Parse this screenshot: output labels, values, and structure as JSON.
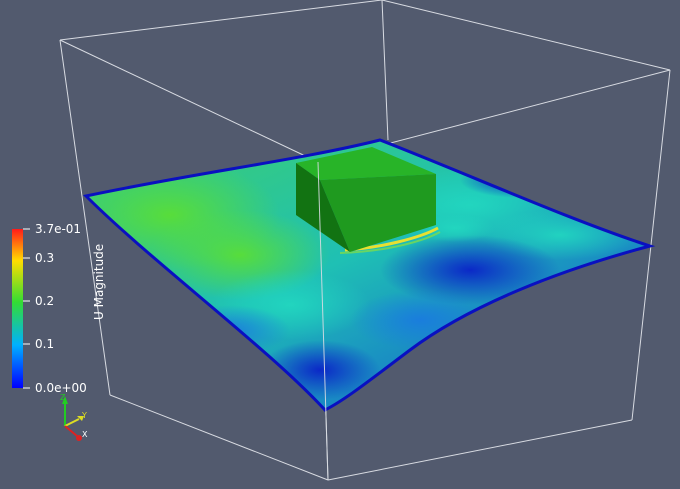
{
  "colors": {
    "background": "#525a6e",
    "bounding_box": "#d8dbe2",
    "block_top": "#28b428",
    "block_front": "#1f9a1f",
    "block_side": "#127312"
  },
  "colorbar": {
    "title": "U Magnitude",
    "ticks": [
      "3.7e-01",
      "0.3",
      "0.2",
      "0.1",
      "0.0e+00"
    ],
    "colormap": [
      "#ff1a1a",
      "#ffdd00",
      "#33dd33",
      "#22ddff",
      "#0000ff"
    ]
  },
  "orientation_axes": {
    "labels": [
      "Z",
      "Y",
      "X"
    ],
    "colors": [
      "#22cc22",
      "#dddd22",
      "#dd2222"
    ]
  }
}
